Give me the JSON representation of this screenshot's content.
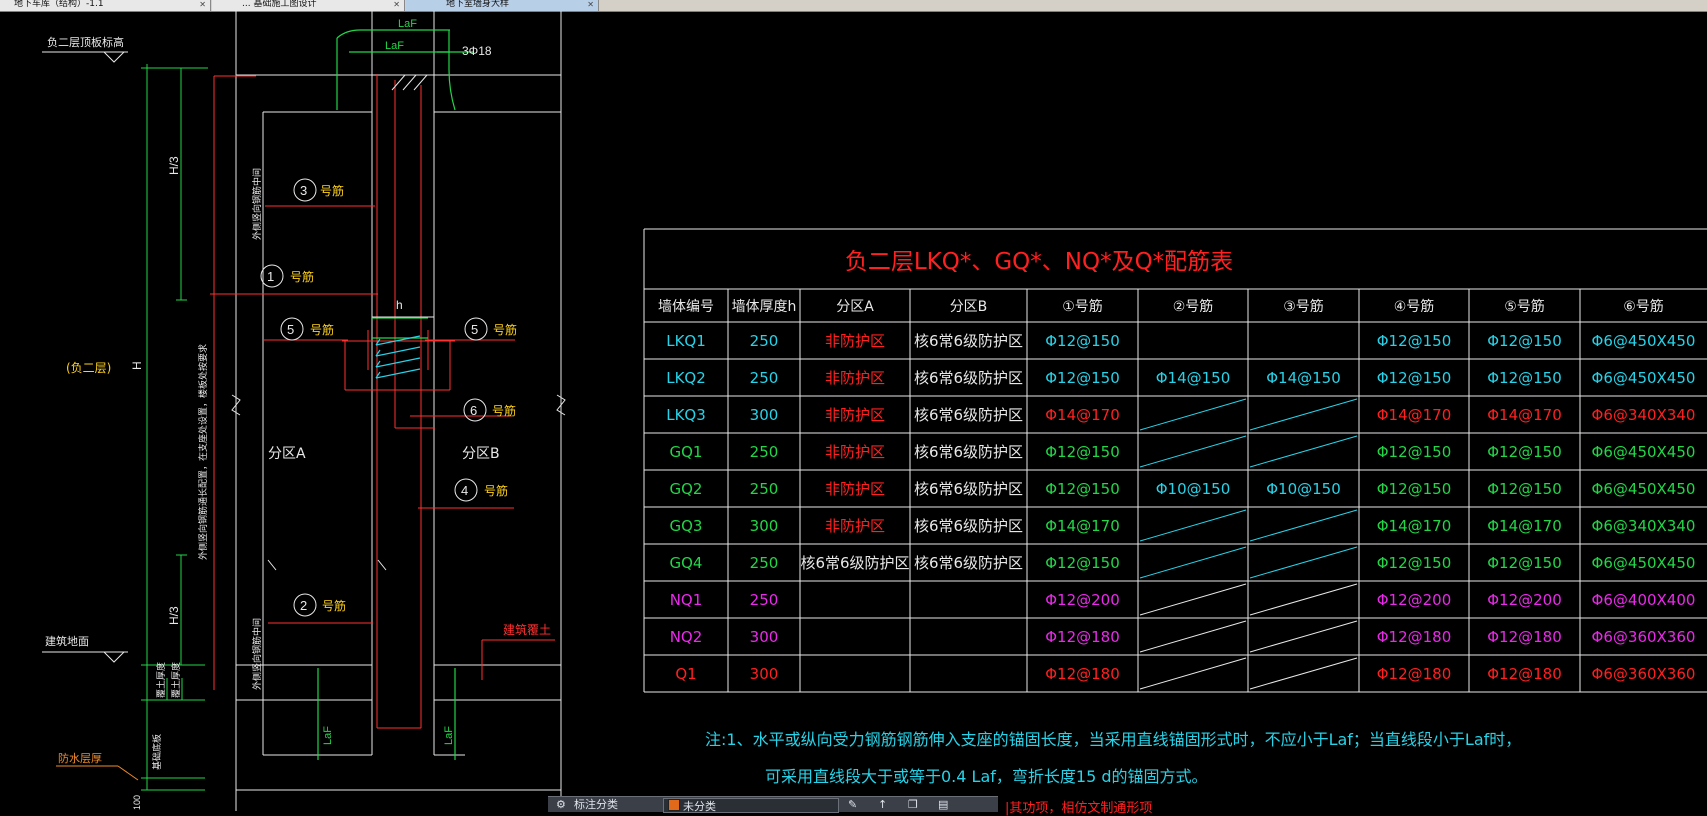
{
  "tabs": [
    {
      "label": "地下车库（结构）-1.1",
      "active": false
    },
    {
      "label": "... 基础施工图设计",
      "active": false
    },
    {
      "label": "地下室墙身大样",
      "active": true
    }
  ],
  "section": {
    "level_label": "负二层顶板标高",
    "laf_top": "LaF",
    "laf_inner": "LaF",
    "top_bars": "3Φ18",
    "h_third_top": "H/3",
    "h_third_bottom": "H/3",
    "H": "H",
    "floor_label": "(负二层)",
    "zone_a": "分区A",
    "zone_b": "分区B",
    "h": "h",
    "bar_suffix": "号筋",
    "bar1": "1",
    "bar2": "2",
    "bar3": "3",
    "bar4": "4",
    "bar5a": "5",
    "bar5b": "5",
    "bar6": "6",
    "note_outer_top": "外侧竖向钢筋中间",
    "note_outer_bottom": "外侧竖向钢筋中间",
    "note_long": "外侧竖向钢筋通长配置，在支座处设置，楼板处按要求",
    "ground_label": "建筑地面",
    "fill_label": "建筑覆土",
    "dim_a": "覆土厚度",
    "dim_b": "覆土厚度",
    "dim_c": "基础底板",
    "waterproof_label": "防水层厚",
    "dim_100": "100",
    "laf_bottom_a": "LaF",
    "laf_bottom_b": "LaF"
  },
  "table": {
    "title": "负二层LKQ*、GQ*、NQ*及Q*配筋表",
    "headers": [
      "墙体编号",
      "墙体厚度h",
      "分区A",
      "分区B",
      "①号筋",
      "②号筋",
      "③号筋",
      "④号筋",
      "⑤号筋",
      "⑥号筋"
    ],
    "rows": [
      {
        "color": "#27d3e8",
        "cells": [
          "LKQ1",
          "250",
          "非防护区",
          "核6常6级防护区",
          "Φ12@150",
          "",
          "",
          "Φ12@150",
          "Φ12@150",
          "Φ6@450X450"
        ],
        "diag": []
      },
      {
        "color": "#27d3e8",
        "cells": [
          "LKQ2",
          "250",
          "非防护区",
          "核6常6级防护区",
          "Φ12@150",
          "Φ14@150",
          "Φ14@150",
          "Φ12@150",
          "Φ12@150",
          "Φ6@450X450"
        ],
        "diag": []
      },
      {
        "color": "#27d3e8",
        "cells": [
          "LKQ3",
          "300",
          "非防护区",
          "核6常6级防护区",
          "Φ14@170",
          "",
          "",
          "Φ14@170",
          "Φ14@170",
          "Φ6@340X340"
        ],
        "diag": [
          5,
          6
        ],
        "red": [
          4,
          7,
          8,
          9
        ]
      },
      {
        "color": "#22d648",
        "cells": [
          "GQ1",
          "250",
          "非防护区",
          "核6常6级防护区",
          "Φ12@150",
          "",
          "",
          "Φ12@150",
          "Φ12@150",
          "Φ6@450X450"
        ],
        "diag": [
          5,
          6
        ]
      },
      {
        "color": "#22d648",
        "cells": [
          "GQ2",
          "250",
          "非防护区",
          "核6常6级防护区",
          "Φ12@150",
          "Φ10@150",
          "Φ10@150",
          "Φ12@150",
          "Φ12@150",
          "Φ6@450X450"
        ],
        "diag": [],
        "cyan": [
          5,
          6
        ]
      },
      {
        "color": "#22d648",
        "cells": [
          "GQ3",
          "300",
          "非防护区",
          "核6常6级防护区",
          "Φ14@170",
          "",
          "",
          "Φ14@170",
          "Φ14@170",
          "Φ6@340X340"
        ],
        "diag": [
          5,
          6
        ]
      },
      {
        "color": "#22d648",
        "cells": [
          "GQ4",
          "250",
          "核6常6级防护区",
          "核6常6级防护区",
          "Φ12@150",
          "",
          "",
          "Φ12@150",
          "Φ12@150",
          "Φ6@450X450"
        ],
        "diag": [
          5,
          6
        ]
      },
      {
        "color": "#ea2aea",
        "cells": [
          "NQ1",
          "250",
          "",
          "",
          "Φ12@200",
          "",
          "",
          "Φ12@200",
          "Φ12@200",
          "Φ6@400X400"
        ],
        "diag": [
          5,
          6
        ]
      },
      {
        "color": "#ea2aea",
        "cells": [
          "NQ2",
          "300",
          "",
          "",
          "Φ12@180",
          "",
          "",
          "Φ12@180",
          "Φ12@180",
          "Φ6@360X360"
        ],
        "diag": [
          5,
          6
        ]
      },
      {
        "color": "#ff2020",
        "cells": [
          "Q1",
          "300",
          "",
          "",
          "Φ12@180",
          "",
          "",
          "Φ12@180",
          "Φ12@180",
          "Φ6@360X360"
        ],
        "diag": [
          5,
          6
        ]
      }
    ]
  },
  "notes": {
    "line1": "注:1、水平或纵向受力钢筋钢筋伸入支座的锚固长度，当采用直线锚固形式时，不应小于Laf；当直线段小于Laf时，",
    "line2": "可采用直线段大于或等于0.4 Laf，弯折长度15 d的锚固方式。"
  },
  "command_bar": {
    "item1": "标注分类",
    "item2": "未分类",
    "status_fragment": "|其功项，相仿文制通形项"
  },
  "colors": {
    "cyan": "#27d3e8",
    "green": "#22d648",
    "magenta": "#ea2aea",
    "red": "#ff2020",
    "yellow": "#ffd21a",
    "white": "#e8e8e8",
    "orange": "#f08a2a"
  }
}
